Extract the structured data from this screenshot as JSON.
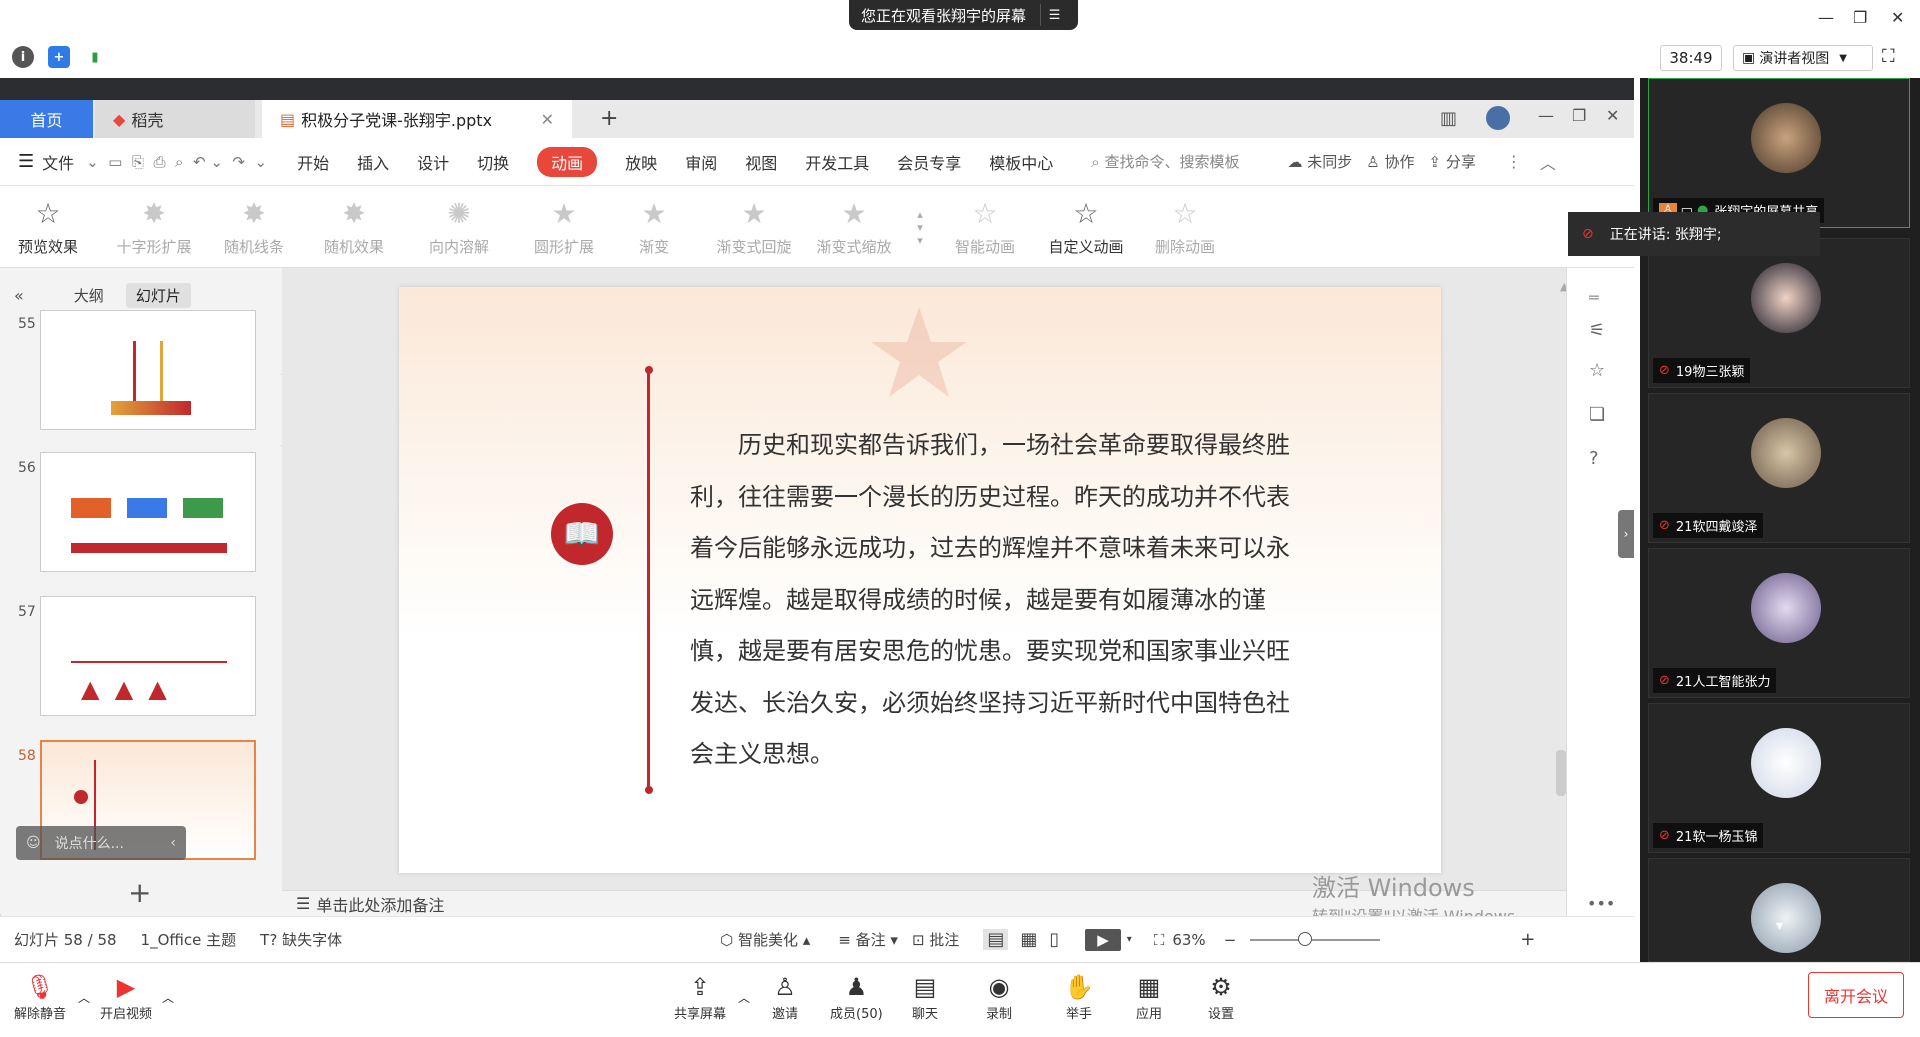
{
  "meeting": {
    "banner": "您正在观看张翔宇的屏幕",
    "timer": "38:49",
    "presenter_view": "演讲者视图",
    "leave": "离开会议"
  },
  "wps": {
    "tabs": {
      "home": "首页",
      "docer": "稻壳",
      "doc": "积极分子党课-张翔宇.pptx"
    },
    "menu": [
      "文件",
      "开始",
      "插入",
      "设计",
      "切换",
      "动画",
      "放映",
      "审阅",
      "视图",
      "开发工具",
      "会员专享",
      "模板中心"
    ],
    "search": "查找命令、搜索模板",
    "sync": "未同步",
    "collab": "协作",
    "share": "分享",
    "ribbon": {
      "preview": "预览效果",
      "effects": [
        "十字形扩展",
        "随机线条",
        "随机效果",
        "向内溶解",
        "圆形扩展",
        "渐变",
        "渐变式回旋",
        "渐变式缩放"
      ],
      "smart": "智能动画",
      "custom": "自定义动画",
      "delete": "删除动画"
    },
    "panel_tabs": {
      "outline": "大纲",
      "slides": "幻灯片"
    },
    "thumbs": [
      {
        "num": "55"
      },
      {
        "num": "56"
      },
      {
        "num": "57"
      },
      {
        "num": "58"
      }
    ],
    "chat_placeholder": "说点什么...",
    "slide_text": "历史和现实都告诉我们，一场社会革命要取得最终胜利，往往需要一个漫长的历史过程。昨天的成功并不代表着今后能够永远成功，过去的辉煌并不意味着未来可以永远辉煌。越是取得成绩的时候，越是要有如履薄冰的谨慎，越是要有居安思危的忧患。要实现党和国家事业兴旺发达、长治久安，必须始终坚持习近平新时代中国特色社会主义思想。",
    "notes": "单击此处添加备注",
    "watermark1": "激活 Windows",
    "watermark2": "转到\"设置\"以激活 Windows。",
    "status": {
      "slide": "幻灯片 58 / 58",
      "theme": "1_Office 主题",
      "font": "缺失字体",
      "beautify": "智能美化",
      "notes": "备注",
      "comment": "批注",
      "zoom": "63%"
    }
  },
  "participants": [
    {
      "name": "张翔宇的屏幕共享"
    },
    {
      "name": "19物三张颖"
    },
    {
      "name": "21软四戴竣泽"
    },
    {
      "name": "21人工智能张力"
    },
    {
      "name": "21软一杨玉锦"
    }
  ],
  "speaking": "正在讲话: 张翔宇;",
  "toolbar": {
    "mute": "解除静音",
    "video": "开启视频",
    "share": "共享屏幕",
    "invite": "邀请",
    "members": "成员(50)",
    "chat": "聊天",
    "record": "录制",
    "raise": "举手",
    "apps": "应用",
    "settings": "设置"
  }
}
